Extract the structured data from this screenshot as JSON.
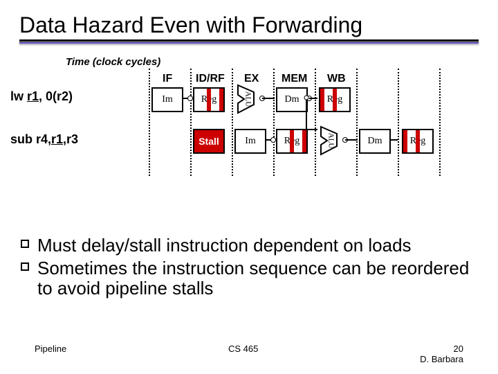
{
  "title": "Data Hazard Even with Forwarding",
  "time_label": "Time (clock cycles)",
  "stage_labels": [
    "IF",
    "ID/RF",
    "EX",
    "MEM",
    "WB"
  ],
  "instructions": {
    "lw": {
      "label_pre": "lw ",
      "label_u": "r1",
      "label_post": ", 0(r2)"
    },
    "sub": {
      "label_pre": "sub r4,",
      "label_u": "r1",
      "label_post": ",r3"
    }
  },
  "units": {
    "im": "Im",
    "reg": "Reg",
    "alu": "ALU",
    "dm": "Dm",
    "stall": "Stall"
  },
  "bullets": [
    "Must delay/stall instruction dependent on loads",
    "Sometimes the instruction sequence can be reordered to avoid pipeline stalls"
  ],
  "footer": {
    "left": "Pipeline",
    "center": "CS 465",
    "page": "20",
    "author": "D. Barbara"
  }
}
